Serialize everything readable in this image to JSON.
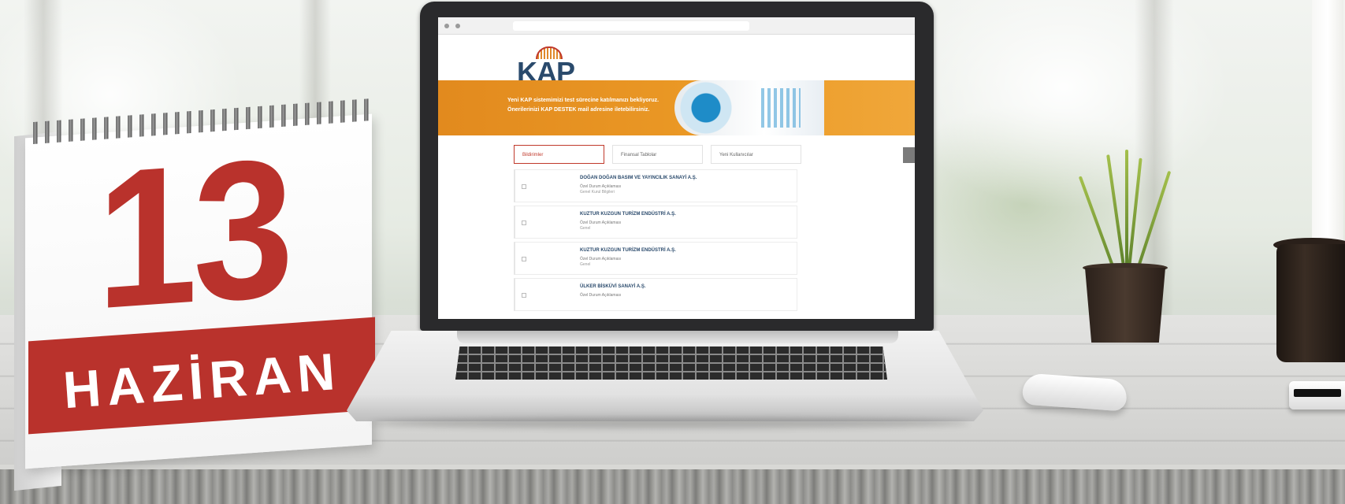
{
  "calendar": {
    "day": "13",
    "month": "HAZİRAN"
  },
  "screen": {
    "logo": "KAP",
    "banner_line1": "Yeni KAP sistemimizi test sürecine katılmanızı bekliyoruz.",
    "banner_line2": "Önerilerinizi KAP DESTEK mail adresine iletebilirsiniz.",
    "tabs": [
      "Bildirimler",
      "Finansal Tablolar",
      "Yeni Kullanıcılar"
    ],
    "rows": [
      {
        "title": "DOĞAN DOĞAN BASIM VE YAYINCILIK SANAYİ A.Ş.",
        "sub": "Özel Durum Açıklaması",
        "sub2": "Genel Kurul Bilgileri"
      },
      {
        "title": "KUZTUR KUZGUN TURİZM ENDÜSTRİ A.Ş.",
        "sub": "Özel Durum Açıklaması",
        "sub2": "Genel"
      },
      {
        "title": "KUZTUR KUZGUN TURİZM ENDÜSTRİ A.Ş.",
        "sub": "Özel Durum Açıklaması",
        "sub2": "Genel"
      },
      {
        "title": "ÜLKER BİSKÜVİ SANAYİ A.Ş.",
        "sub": "Özel Durum Açıklaması",
        "sub2": ""
      }
    ]
  }
}
